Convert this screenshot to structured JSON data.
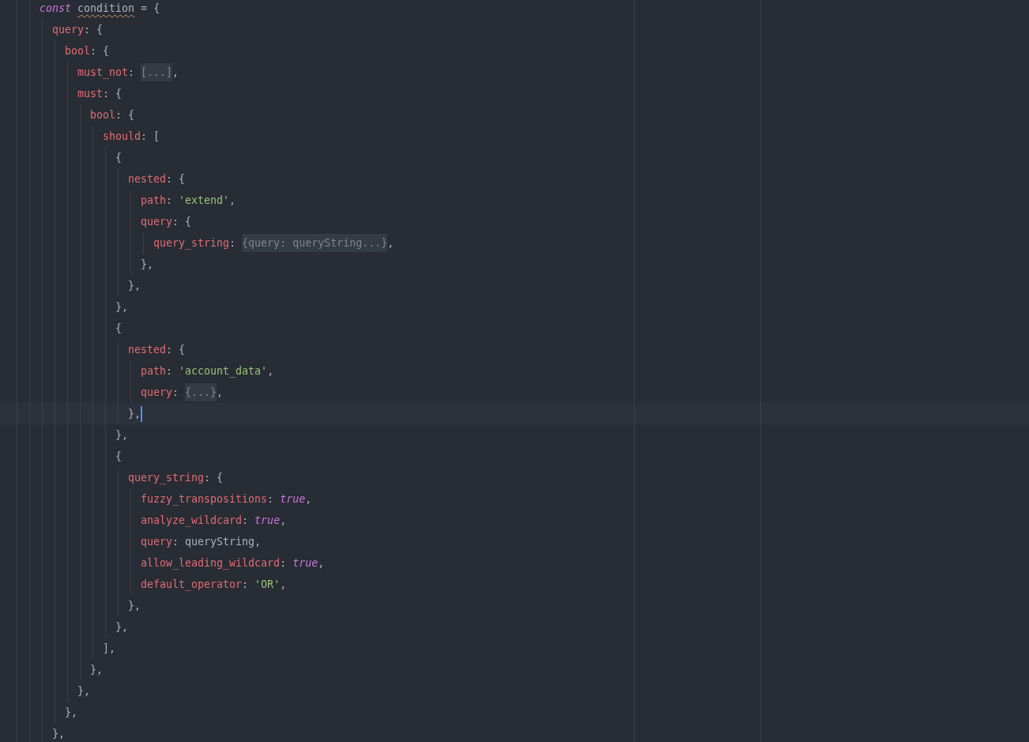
{
  "editor": {
    "lines": [
      {
        "active": false,
        "tokens": [
          {
            "kind": "keyword",
            "text": "const "
          },
          {
            "kind": "flagged",
            "text": "condition"
          },
          {
            "kind": "punct",
            "text": " = {"
          }
        ],
        "children": [
          {
            "active": false,
            "tokens": [
              {
                "kind": "property",
                "text": "query"
              },
              {
                "kind": "punct",
                "text": ": {"
              }
            ],
            "children": [
              {
                "active": false,
                "tokens": [
                  {
                    "kind": "property",
                    "text": "bool"
                  },
                  {
                    "kind": "punct",
                    "text": ": {"
                  }
                ],
                "children": [
                  {
                    "active": false,
                    "tokens": [
                      {
                        "kind": "property",
                        "text": "must_not"
                      },
                      {
                        "kind": "punct",
                        "text": ": "
                      },
                      {
                        "kind": "folded",
                        "text": "[...]"
                      },
                      {
                        "kind": "punct",
                        "text": ","
                      }
                    ]
                  },
                  {
                    "active": false,
                    "tokens": [
                      {
                        "kind": "property",
                        "text": "must"
                      },
                      {
                        "kind": "punct",
                        "text": ": {"
                      }
                    ],
                    "children": [
                      {
                        "active": false,
                        "tokens": [
                          {
                            "kind": "property",
                            "text": "bool"
                          },
                          {
                            "kind": "punct",
                            "text": ": {"
                          }
                        ],
                        "children": [
                          {
                            "active": false,
                            "tokens": [
                              {
                                "kind": "property",
                                "text": "should"
                              },
                              {
                                "kind": "punct",
                                "text": ": ["
                              }
                            ],
                            "children": [
                              {
                                "active": false,
                                "tokens": [
                                  {
                                    "kind": "punct",
                                    "text": "{"
                                  }
                                ],
                                "children": [
                                  {
                                    "active": false,
                                    "tokens": [
                                      {
                                        "kind": "property",
                                        "text": "nested"
                                      },
                                      {
                                        "kind": "punct",
                                        "text": ": {"
                                      }
                                    ],
                                    "children": [
                                      {
                                        "active": false,
                                        "tokens": [
                                          {
                                            "kind": "property",
                                            "text": "path"
                                          },
                                          {
                                            "kind": "punct",
                                            "text": ": "
                                          },
                                          {
                                            "kind": "string",
                                            "text": "'extend'"
                                          },
                                          {
                                            "kind": "punct",
                                            "text": ","
                                          }
                                        ]
                                      },
                                      {
                                        "active": false,
                                        "tokens": [
                                          {
                                            "kind": "property",
                                            "text": "query"
                                          },
                                          {
                                            "kind": "punct",
                                            "text": ": {"
                                          }
                                        ],
                                        "children": [
                                          {
                                            "active": false,
                                            "tokens": [
                                              {
                                                "kind": "property",
                                                "text": "query_string"
                                              },
                                              {
                                                "kind": "punct",
                                                "text": ": "
                                              },
                                              {
                                                "kind": "folded",
                                                "text": "{query: queryString...}"
                                              },
                                              {
                                                "kind": "punct",
                                                "text": ","
                                              }
                                            ]
                                          }
                                        ]
                                      },
                                      {
                                        "active": false,
                                        "tokens": [
                                          {
                                            "kind": "punct",
                                            "text": "},"
                                          }
                                        ]
                                      }
                                    ]
                                  },
                                  {
                                    "active": false,
                                    "tokens": [
                                      {
                                        "kind": "punct",
                                        "text": "},"
                                      }
                                    ]
                                  }
                                ]
                              },
                              {
                                "active": false,
                                "tokens": [
                                  {
                                    "kind": "punct",
                                    "text": "},"
                                  }
                                ]
                              },
                              {
                                "active": false,
                                "tokens": [
                                  {
                                    "kind": "punct",
                                    "text": "{"
                                  }
                                ],
                                "children": [
                                  {
                                    "active": false,
                                    "tokens": [
                                      {
                                        "kind": "property",
                                        "text": "nested"
                                      },
                                      {
                                        "kind": "punct",
                                        "text": ": {"
                                      }
                                    ],
                                    "children": [
                                      {
                                        "active": false,
                                        "tokens": [
                                          {
                                            "kind": "property",
                                            "text": "path"
                                          },
                                          {
                                            "kind": "punct",
                                            "text": ": "
                                          },
                                          {
                                            "kind": "string",
                                            "text": "'account_data'"
                                          },
                                          {
                                            "kind": "punct",
                                            "text": ","
                                          }
                                        ]
                                      },
                                      {
                                        "active": false,
                                        "tokens": [
                                          {
                                            "kind": "property",
                                            "text": "query"
                                          },
                                          {
                                            "kind": "punct",
                                            "text": ": "
                                          },
                                          {
                                            "kind": "folded",
                                            "text": "{...}"
                                          },
                                          {
                                            "kind": "punct",
                                            "text": ","
                                          }
                                        ]
                                      }
                                    ]
                                  },
                                  {
                                    "active": true,
                                    "tokens": [
                                      {
                                        "kind": "punct",
                                        "text": "},"
                                      }
                                    ]
                                  }
                                ]
                              },
                              {
                                "active": false,
                                "tokens": [
                                  {
                                    "kind": "punct",
                                    "text": "},"
                                  }
                                ]
                              },
                              {
                                "active": false,
                                "tokens": [
                                  {
                                    "kind": "punct",
                                    "text": "{"
                                  }
                                ],
                                "children": [
                                  {
                                    "active": false,
                                    "tokens": [
                                      {
                                        "kind": "property",
                                        "text": "query_string"
                                      },
                                      {
                                        "kind": "punct",
                                        "text": ": {"
                                      }
                                    ],
                                    "children": [
                                      {
                                        "active": false,
                                        "tokens": [
                                          {
                                            "kind": "property",
                                            "text": "fuzzy_transpositions"
                                          },
                                          {
                                            "kind": "punct",
                                            "text": ": "
                                          },
                                          {
                                            "kind": "literal",
                                            "text": "true"
                                          },
                                          {
                                            "kind": "punct",
                                            "text": ","
                                          }
                                        ]
                                      },
                                      {
                                        "active": false,
                                        "tokens": [
                                          {
                                            "kind": "property",
                                            "text": "analyze_wildcard"
                                          },
                                          {
                                            "kind": "punct",
                                            "text": ": "
                                          },
                                          {
                                            "kind": "literal",
                                            "text": "true"
                                          },
                                          {
                                            "kind": "punct",
                                            "text": ","
                                          }
                                        ]
                                      },
                                      {
                                        "active": false,
                                        "tokens": [
                                          {
                                            "kind": "property",
                                            "text": "query"
                                          },
                                          {
                                            "kind": "punct",
                                            "text": ": queryString,"
                                          }
                                        ]
                                      },
                                      {
                                        "active": false,
                                        "tokens": [
                                          {
                                            "kind": "property",
                                            "text": "allow_leading_wildcard"
                                          },
                                          {
                                            "kind": "punct",
                                            "text": ": "
                                          },
                                          {
                                            "kind": "literal",
                                            "text": "true"
                                          },
                                          {
                                            "kind": "punct",
                                            "text": ","
                                          }
                                        ]
                                      },
                                      {
                                        "active": false,
                                        "tokens": [
                                          {
                                            "kind": "property",
                                            "text": "default_operator"
                                          },
                                          {
                                            "kind": "punct",
                                            "text": ": "
                                          },
                                          {
                                            "kind": "string",
                                            "text": "'OR'"
                                          },
                                          {
                                            "kind": "punct",
                                            "text": ","
                                          }
                                        ]
                                      }
                                    ]
                                  },
                                  {
                                    "active": false,
                                    "tokens": [
                                      {
                                        "kind": "punct",
                                        "text": "},"
                                      }
                                    ]
                                  }
                                ]
                              },
                              {
                                "active": false,
                                "tokens": [
                                  {
                                    "kind": "punct",
                                    "text": "},"
                                  }
                                ]
                              }
                            ]
                          },
                          {
                            "active": false,
                            "tokens": [
                              {
                                "kind": "punct",
                                "text": "],"
                              }
                            ]
                          }
                        ]
                      },
                      {
                        "active": false,
                        "tokens": [
                          {
                            "kind": "punct",
                            "text": "},"
                          }
                        ]
                      }
                    ]
                  },
                  {
                    "active": false,
                    "tokens": [
                      {
                        "kind": "punct",
                        "text": "},"
                      }
                    ]
                  }
                ]
              },
              {
                "active": false,
                "tokens": [
                  {
                    "kind": "punct",
                    "text": "},"
                  }
                ]
              }
            ]
          },
          {
            "active": false,
            "tokens": [
              {
                "kind": "punct",
                "text": "},"
              }
            ]
          }
        ]
      }
    ]
  }
}
